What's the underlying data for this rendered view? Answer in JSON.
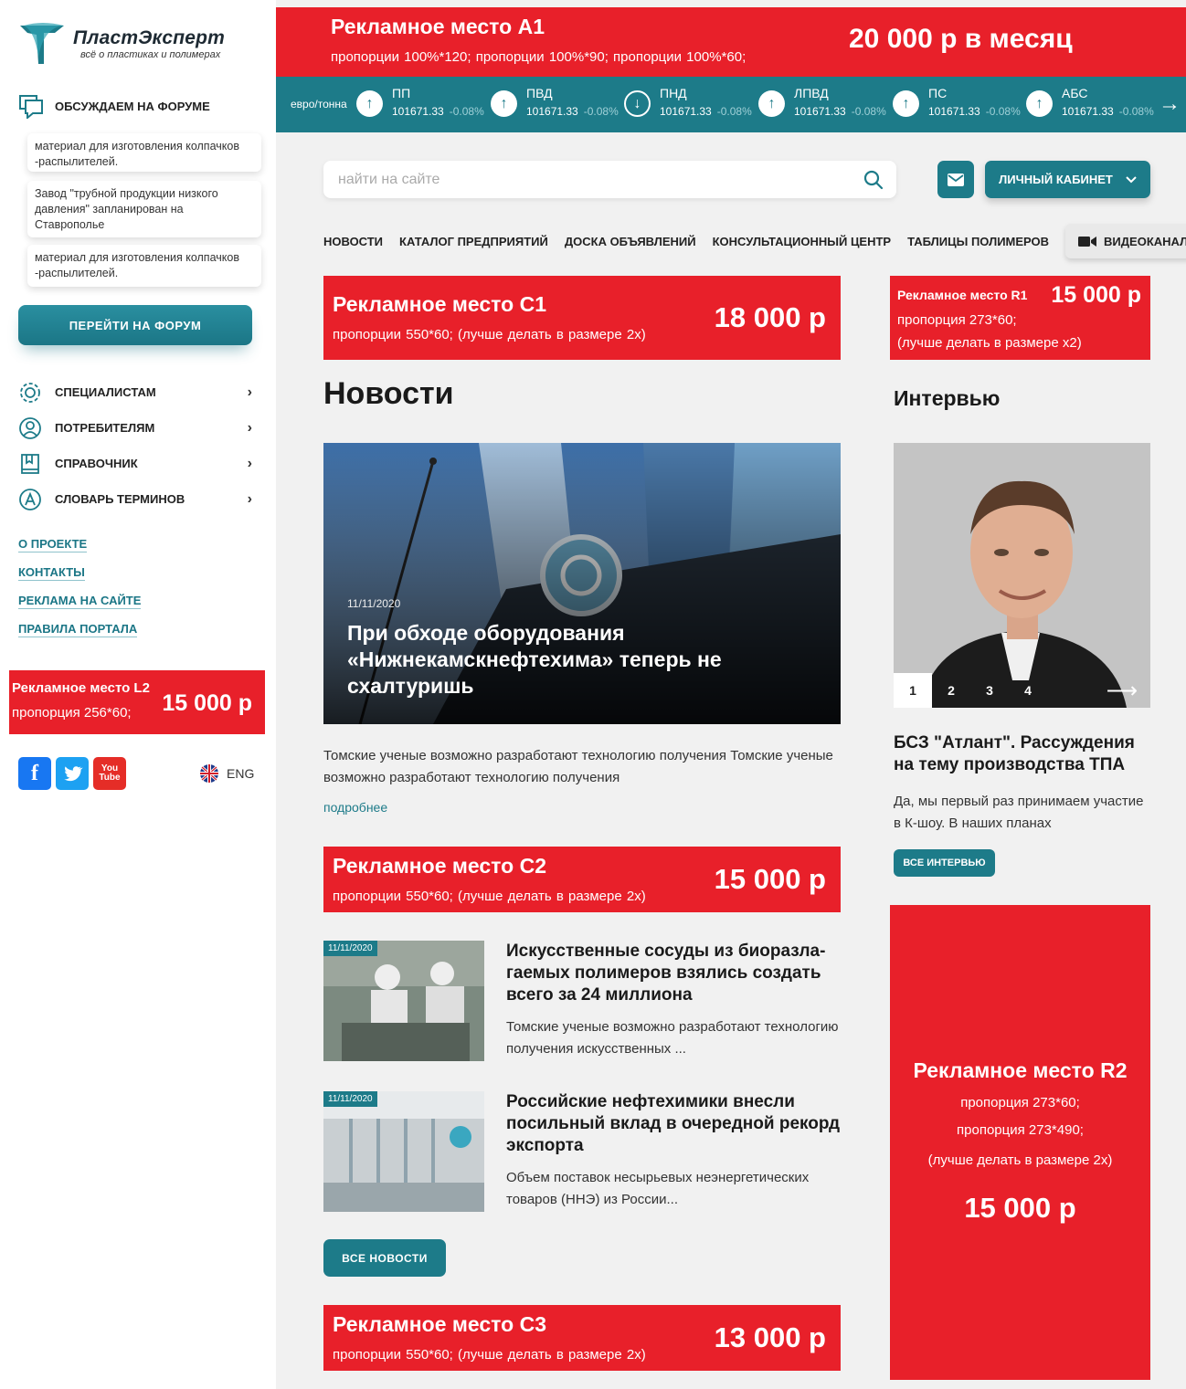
{
  "brand": {
    "name": "ПластЭксперт",
    "tagline": "всё о пластиках и полимерах",
    "accent": "#1d7b89",
    "ad_color": "#e8202a"
  },
  "sidebar": {
    "forum_title": "ОБСУЖДАЕМ НА ФОРУМЕ",
    "forum_items": [
      "материал для изготовления колпачков -распылителей.",
      "Завод \"трубной продукции низкого давления\" запланирован на Ставрополье",
      "материал для изготовления колпачков -распылителей."
    ],
    "forum_button": "ПЕРЕЙТИ НА ФОРУМ",
    "menu": [
      {
        "label": "СПЕЦИАЛИСТАМ",
        "icon": "gear-icon"
      },
      {
        "label": "ПОТРЕБИТЕЛЯМ",
        "icon": "user-icon"
      },
      {
        "label": "СПРАВОЧНИК",
        "icon": "book-icon"
      },
      {
        "label": "СЛОВАРЬ ТЕРМИНОВ",
        "icon": "glossary-icon"
      }
    ],
    "links": [
      "О ПРОЕКТЕ",
      "КОНТАКТЫ",
      "РЕКЛАМА НА САЙТЕ",
      "ПРАВИЛА ПОРТАЛА"
    ],
    "ad": {
      "title": "Рекламное место L2",
      "proportion": "пропорция 256*60;",
      "price": "15 000 р"
    },
    "lang": "ENG"
  },
  "top_ad": {
    "title": "Рекламное место А1",
    "proportions": "пропорции 100%*120;  пропорции 100%*90;  пропорции 100%*60;",
    "price": "20 000 р в месяц"
  },
  "ticker": {
    "unit": "евро/тонна",
    "items": [
      {
        "name": "ПП",
        "value": "101671.33",
        "change": "-0.08%",
        "dir": "up"
      },
      {
        "name": "ПВД",
        "value": "101671.33",
        "change": "-0.08%",
        "dir": "up"
      },
      {
        "name": "ПНД",
        "value": "101671.33",
        "change": "-0.08%",
        "dir": "down"
      },
      {
        "name": "ЛПВД",
        "value": "101671.33",
        "change": "-0.08%",
        "dir": "up"
      },
      {
        "name": "ПС",
        "value": "101671.33",
        "change": "-0.08%",
        "dir": "up"
      },
      {
        "name": "АБС",
        "value": "101671.33",
        "change": "-0.08%",
        "dir": "up"
      }
    ]
  },
  "header": {
    "search_placeholder": "найти на сайте",
    "cabinet": "ЛИЧНЫЙ КАБИНЕТ"
  },
  "nav": [
    "НОВОСТИ",
    "КАТАЛОГ ПРЕДПРИЯТИЙ",
    "ДОСКА ОБЪЯВЛЕНИЙ",
    "КОНСУЛЬТАЦИОННЫЙ ЦЕНТР",
    "ТАБЛИЦЫ ПОЛИМЕРОВ"
  ],
  "nav_video": "ВИДЕОКАНАЛ",
  "ads_c": [
    {
      "title": "Рекламное место С1",
      "proportion": "пропорции 550*60;  (лучше делать в размере 2х)",
      "price": "18 000 р"
    },
    {
      "title": "Рекламное место С2",
      "proportion": "пропорции 550*60;  (лучше делать в размере 2х)",
      "price": "15 000 р"
    },
    {
      "title": "Рекламное место С3",
      "proportion": "пропорции 550*60;  (лучше делать в размере 2х)",
      "price": "13 000 р"
    }
  ],
  "ad_r1": {
    "title": "Рекламное место R1",
    "price": "15 000 р",
    "p1": "пропорция 273*60;",
    "p2": "(лучше делать в размере х2)"
  },
  "news": {
    "heading": "Новости",
    "featured": {
      "date": "11/11/2020",
      "title": "При обходе оборудования «Нижнекамскнефтехима» теперь не схалтуришь"
    },
    "lead": "Томские ученые возможно разработают технологию получения Томские ученые возможно разработают технологию получения",
    "more": "подробнее",
    "items": [
      {
        "date": "11/11/2020",
        "title": "Искусственные сосуды из биоразла-гаемых полимеров взялись создать всего за 24 миллиона",
        "text": "Томские ученые возможно разработают технологию получения искусственных ..."
      },
      {
        "date": "11/11/2020",
        "title": "Российские нефтехимики внесли посильный вклад в очередной рекорд экспорта",
        "text": "Объем поставок несырьевых неэнергетических товаров (ННЭ) из России..."
      }
    ],
    "all_button": "ВСЕ НОВОСТИ"
  },
  "interview": {
    "heading": "Интервью",
    "pages": [
      "1",
      "2",
      "3",
      "4"
    ],
    "title": "БСЗ \"Атлант\". Рассуждения на тему производства ТПА",
    "text": "Да, мы первый раз принимаем участие в К-шоу. В наших планах",
    "button": "ВСЕ ИНТЕРВЬЮ"
  },
  "ad_r2": {
    "title": "Рекламное место R2",
    "p1": "пропорция 273*60;",
    "p2": "пропорция 273*490;",
    "p3": "(лучше делать в размере 2х)",
    "price": "15 000 р"
  }
}
